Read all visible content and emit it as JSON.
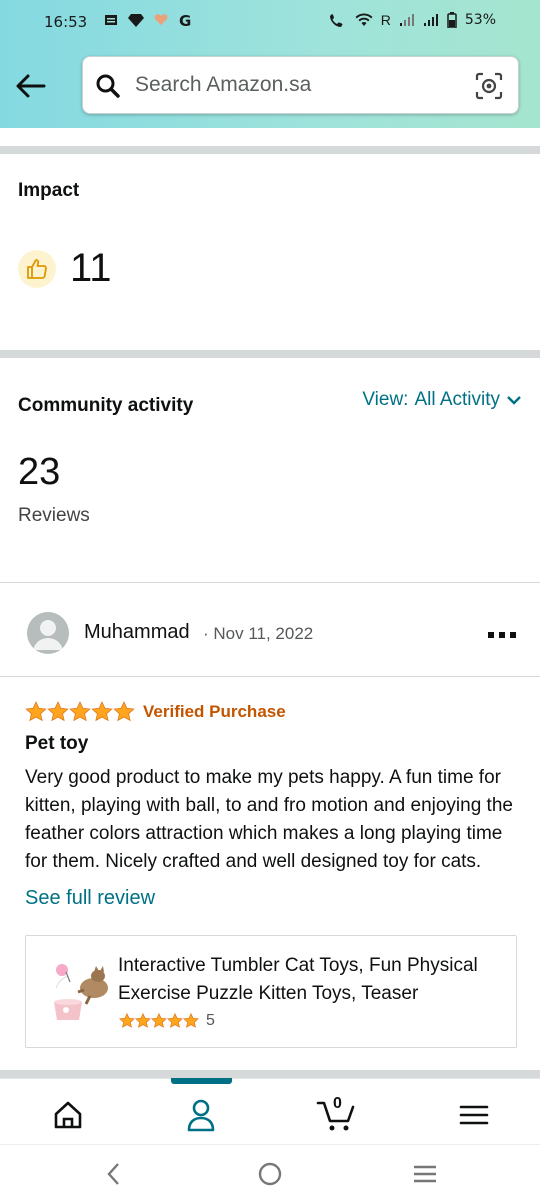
{
  "status_bar": {
    "time": "16:53",
    "network_label": "R",
    "battery": "53%"
  },
  "search": {
    "placeholder": "Search Amazon.sa"
  },
  "impact": {
    "title": "Impact",
    "helpful_count": "11"
  },
  "community": {
    "title": "Community activity",
    "view_prefix": "View:",
    "view_value": "All Activity",
    "reviews_count": "23",
    "reviews_label": "Reviews"
  },
  "review": {
    "reviewer": "Muhammad",
    "date": "· Nov 11, 2022",
    "rating": 5,
    "verified": "Verified Purchase",
    "title": "Pet toy",
    "body": "Very good product to make my pets happy. A fun time for kitten, playing with ball, to and fro motion and enjoying the feather colors attraction which makes a long playing time for them. Nicely crafted and well designed toy for cats.",
    "see_full": "See full review"
  },
  "product": {
    "title": "Interactive Tumbler Cat Toys, Fun Physical Exercise Puzzle Kitten Toys, Teaser",
    "rating": 5,
    "rating_count": "5"
  },
  "bottom_nav": {
    "active": "account",
    "cart_count": "0",
    "items": [
      "home",
      "account",
      "cart",
      "menu"
    ]
  },
  "colors": {
    "accent": "#007185",
    "star": "#ffa41c",
    "verified": "#c45500",
    "header_gradient_start": "#84d9e1",
    "header_gradient_end": "#a5e5cf"
  }
}
